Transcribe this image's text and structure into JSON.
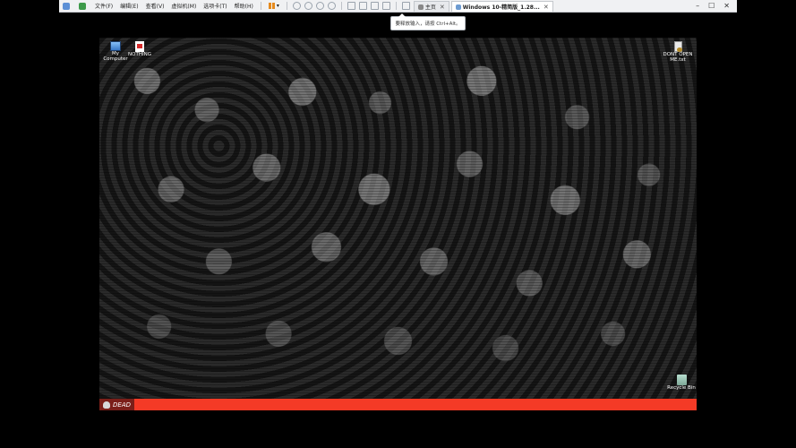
{
  "toolbar": {
    "menus": [
      {
        "label": "文件(F)"
      },
      {
        "label": "编辑(E)"
      },
      {
        "label": "查看(V)"
      },
      {
        "label": "虚拟机(M)"
      },
      {
        "label": "选项卡(T)"
      },
      {
        "label": "帮助(H)"
      }
    ],
    "tabs": [
      {
        "label": "主页",
        "icon": "home-icon"
      },
      {
        "label": "Windows 10-精简版_1.28...",
        "icon": "vm-icon"
      }
    ]
  },
  "tooltip": {
    "text": "要释放输入，请按 Ctrl+Alt。"
  },
  "desktop": {
    "icons": [
      {
        "label": "My Computer",
        "icon": "computer-icon"
      },
      {
        "label": "NOTHING",
        "icon": "pdf-icon"
      },
      {
        "label": "DONT OPEN ME.txt",
        "icon": "text-file-icon"
      },
      {
        "label": "Recycle Bin",
        "icon": "recycle-bin-icon"
      }
    ],
    "wallpaper": "skulls"
  },
  "taskbar": {
    "start_label": "DEAD",
    "color": "#f43a26"
  }
}
